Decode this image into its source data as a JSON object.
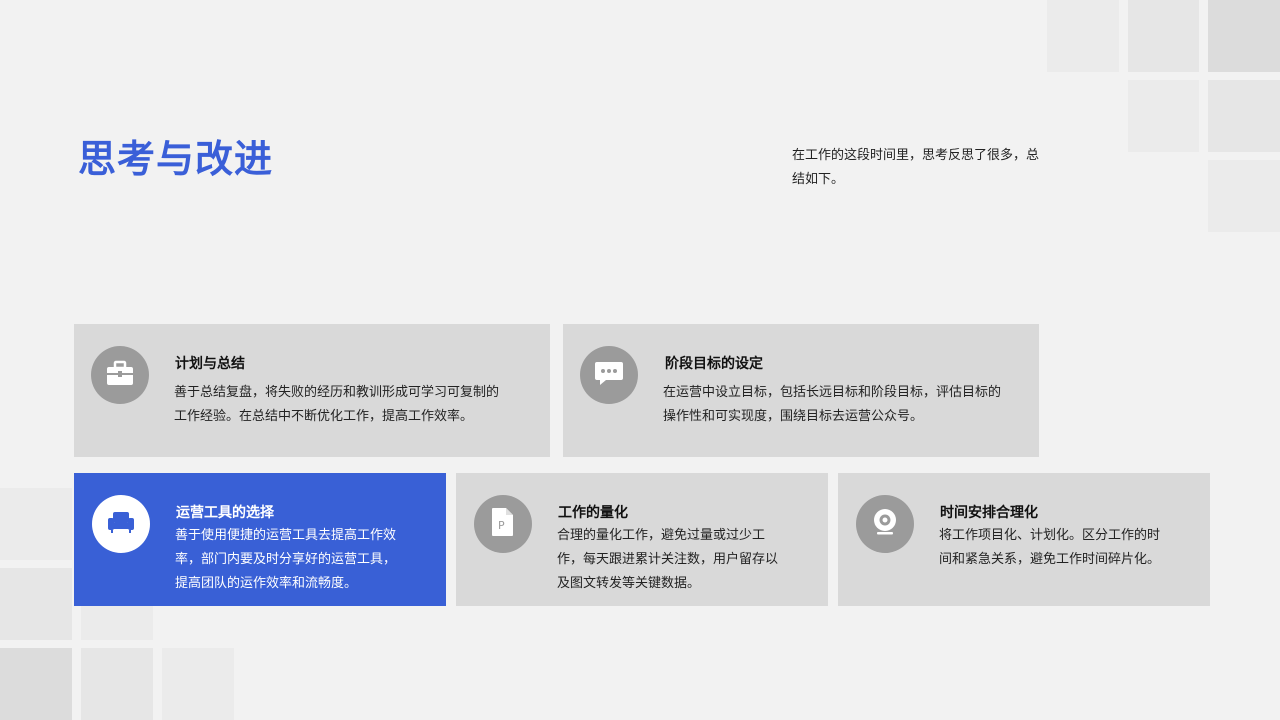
{
  "header": {
    "title": "思考与改进",
    "intro": "在工作的这段时间里，思考反思了很多，总结如下。"
  },
  "cards": [
    {
      "title": "计划与总结",
      "body": "善于总结复盘，将失败的经历和教训形成可学习可复制的工作经验。在总结中不断优化工作，提高工作效率。",
      "icon": "briefcase-icon"
    },
    {
      "title": "阶段目标的设定",
      "body": "在运营中设立目标，包括长远目标和阶段目标，评估目标的操作性和可实现度，围绕目标去运营公众号。",
      "icon": "chat-bubble-icon"
    },
    {
      "title": "运营工具的选择",
      "body": "善于使用便捷的运营工具去提高工作效率，部门内要及时分享好的运营工具，提高团队的运作效率和流畅度。",
      "icon": "armchair-icon"
    },
    {
      "title": "工作的量化",
      "body": "合理的量化工作，避免过量或过少工作，每天跟进累计关注数，用户留存以及图文转发等关键数据。",
      "icon": "document-icon"
    },
    {
      "title": "时间安排合理化",
      "body": "将工作项目化、计划化。区分工作的时间和紧急关系，避免工作时间碎片化。",
      "icon": "webcam-icon"
    }
  ],
  "colors": {
    "accent": "#3960d6",
    "card": "#d9d9d9",
    "icon_circle": "#9b9b9b",
    "background": "#f2f2f2"
  }
}
